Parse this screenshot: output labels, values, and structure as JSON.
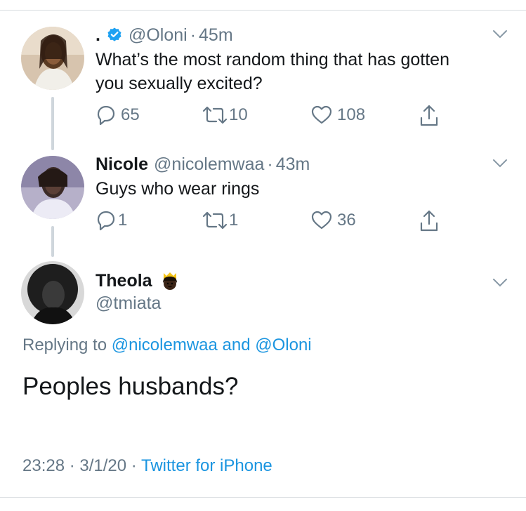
{
  "tweet1": {
    "display_name": ".",
    "handle": "@Oloni",
    "sep": "·",
    "time": "45m",
    "text_line1": "What’s the most random thing that has gotten",
    "text_line2": "you sexually excited?",
    "replies": "65",
    "retweets": "10",
    "likes": "108"
  },
  "tweet2": {
    "display_name": "Nicole",
    "handle": "@nicolemwaa",
    "sep": "·",
    "time": "43m",
    "text": "Guys who wear rings",
    "replies": "1",
    "retweets": "1",
    "likes": "36"
  },
  "tweet3": {
    "display_name": "Theola",
    "emoji": "🤴🏿",
    "handle": "@tmiata",
    "replying_prefix": "Replying to",
    "replying_user1": "@nicolemwaa",
    "replying_and": "and",
    "replying_user2": "@Oloni",
    "text": "Peoples husbands?",
    "timestamp": "23:28 · 3/1/20 ·",
    "source": "Twitter for iPhone"
  },
  "colors": {
    "link": "#1b95e0",
    "muted": "#657786",
    "verified": "#1da1f2"
  }
}
